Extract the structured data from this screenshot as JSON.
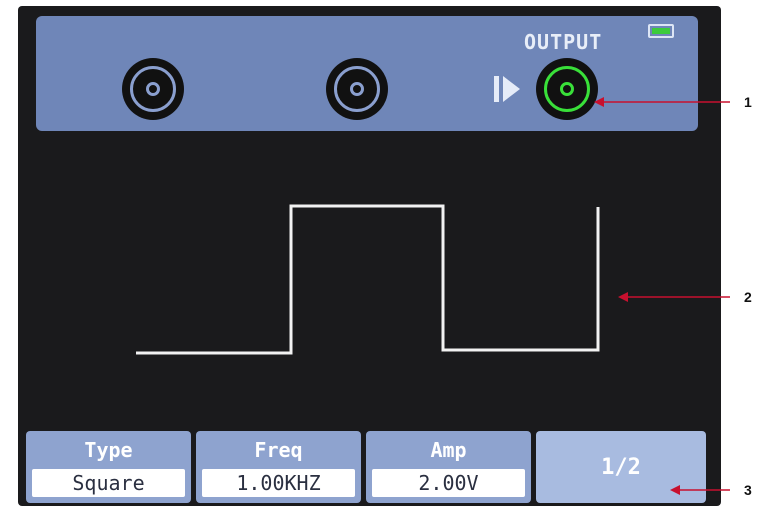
{
  "header": {
    "output_label": "OUTPUT",
    "battery_icon": "battery-icon",
    "ports": [
      {
        "name": "channel-port-1",
        "active": false
      },
      {
        "name": "channel-port-2",
        "active": false
      },
      {
        "name": "output-port",
        "active": true
      }
    ],
    "arrow_icon": "play-arrow-icon"
  },
  "waveform": {
    "type": "square",
    "color": "#f2f2f2"
  },
  "softkeys": [
    {
      "label": "Type",
      "value": "Square"
    },
    {
      "label": "Freq",
      "value": "1.00KHZ"
    },
    {
      "label": "Amp",
      "value": "2.00V"
    },
    {
      "label": "",
      "value": "1/2"
    }
  ],
  "annotations": {
    "marker_1": "1",
    "marker_2": "2",
    "marker_3": "3",
    "arrow_color": "#c8102e"
  },
  "colors": {
    "topbar": "#6f86b8",
    "active_port": "#39e039",
    "screen_bg": "#1a1a1c"
  }
}
